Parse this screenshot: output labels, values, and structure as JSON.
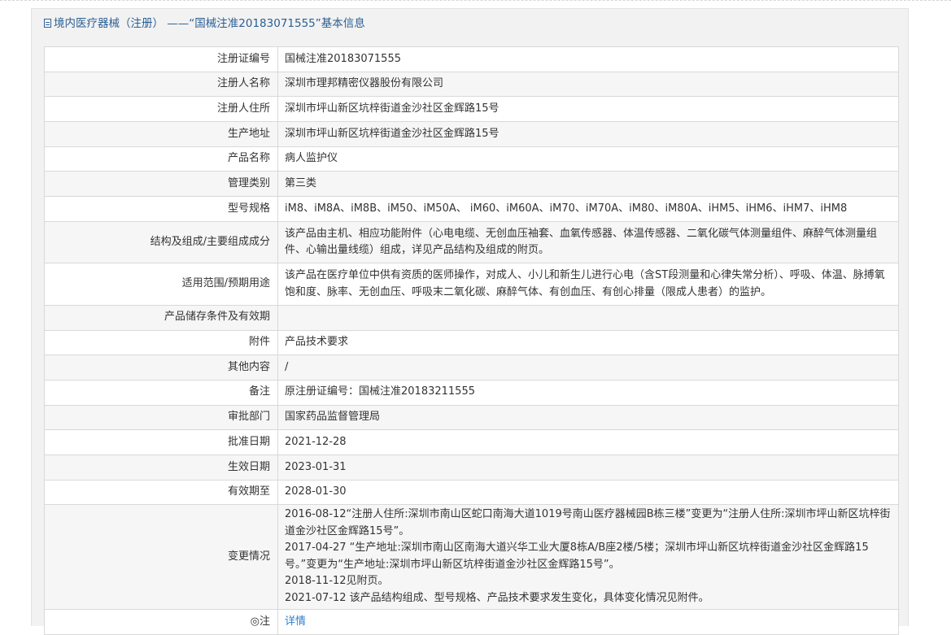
{
  "header": {
    "title": "境内医疗器械（注册） ——“国械注准20183071555”基本信息"
  },
  "rows": [
    {
      "label": "注册证编号",
      "value": "国械注准20183071555"
    },
    {
      "label": "注册人名称",
      "value": "深圳市理邦精密仪器股份有限公司"
    },
    {
      "label": "注册人住所",
      "value": "深圳市坪山新区坑梓街道金沙社区金辉路15号"
    },
    {
      "label": "生产地址",
      "value": "深圳市坪山新区坑梓街道金沙社区金辉路15号"
    },
    {
      "label": "产品名称",
      "value": "病人监护仪"
    },
    {
      "label": "管理类别",
      "value": "第三类"
    },
    {
      "label": "型号规格",
      "value": "iM8、iM8A、iM8B、iM50、iM50A、 iM60、iM60A、iM70、iM70A、iM80、iM80A、iHM5、iHM6、iHM7、iHM8"
    },
    {
      "label": "结构及组成/主要组成成分",
      "value": "该产品由主机、相应功能附件（心电电缆、无创血压袖套、血氧传感器、体温传感器、二氧化碳气体测量组件、麻醉气体测量组件、心输出量线缆）组成，详见产品结构及组成的附页。"
    },
    {
      "label": "适用范围/预期用途",
      "value": "该产品在医疗单位中供有资质的医师操作，对成人、小儿和新生儿进行心电（含ST段测量和心律失常分析）、呼吸、体温、脉搏氧饱和度、脉率、无创血压、呼吸末二氧化碳、麻醉气体、有创血压、有创心排量（限成人患者）的监护。"
    },
    {
      "label": "产品储存条件及有效期",
      "value": ""
    },
    {
      "label": "附件",
      "value": "产品技术要求"
    },
    {
      "label": "其他内容",
      "value": "/"
    },
    {
      "label": "备注",
      "value": "原注册证编号：国械注准20183211555"
    },
    {
      "label": "审批部门",
      "value": "国家药品监督管理局"
    },
    {
      "label": "批准日期",
      "value": "2021-12-28"
    },
    {
      "label": "生效日期",
      "value": "2023-01-31"
    },
    {
      "label": "有效期至",
      "value": "2028-01-30"
    }
  ],
  "changes": {
    "label": "变更情况",
    "lines": [
      "2016-08-12“注册人住所:深圳市南山区蛇口南海大道1019号南山医疗器械园B栋三楼”变更为“注册人住所:深圳市坪山新区坑梓街道金沙社区金辉路15号”。",
      "2017-04-27 “生产地址:深圳市南山区南海大道兴华工业大厦8栋A/B座2楼/5楼；深圳市坪山新区坑梓街道金沙社区金辉路15号。”变更为“生产地址:深圳市坪山新区坑梓街道金沙社区金辉路15号”。",
      "2018-11-12见附页。",
      "2021-07-12 该产品结构组成、型号规格、产品技术要求发生变化，具体变化情况见附件。"
    ]
  },
  "detail_row": {
    "label": "◎注",
    "link": "详情"
  }
}
